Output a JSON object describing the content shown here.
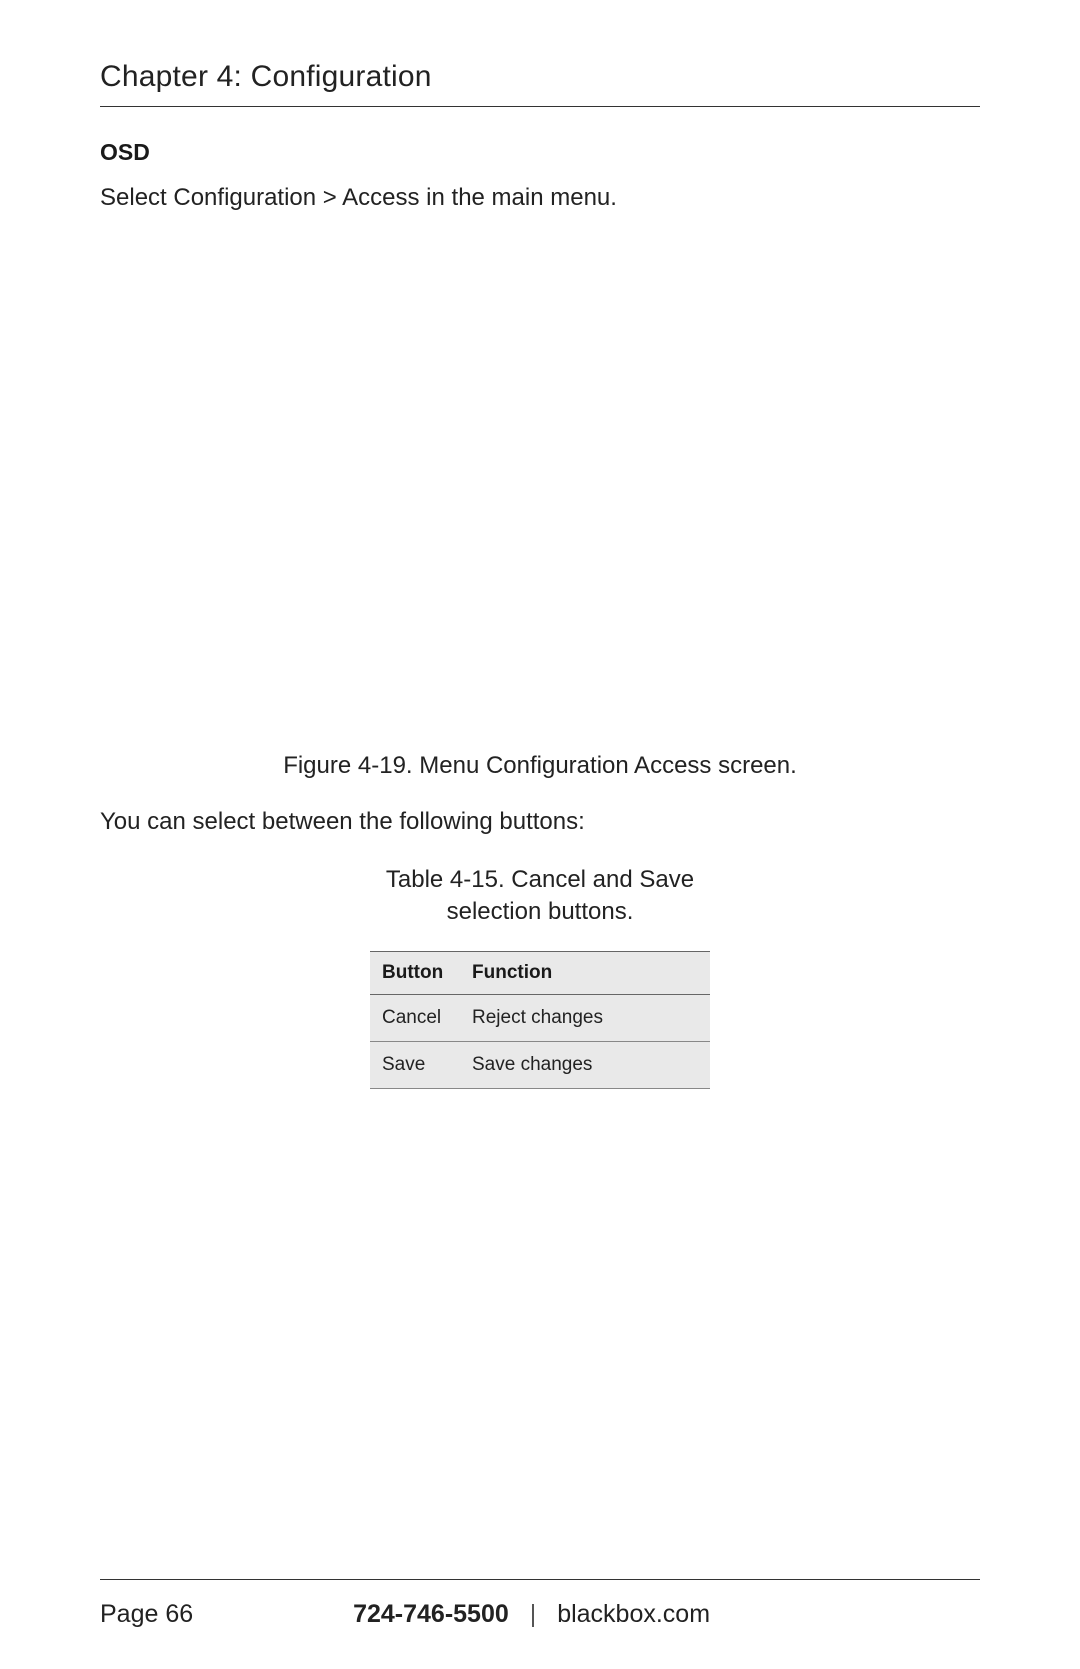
{
  "chapter_title": "Chapter 4: Configuration",
  "section_label": "OSD",
  "instruction": "Select Configuration > Access in the main menu.",
  "figure_caption": "Figure 4-19. Menu Configuration Access screen.",
  "body_text": "You can select between the following buttons:",
  "table_caption_line1": "Table 4-15. Cancel and Save",
  "table_caption_line2": "selection buttons.",
  "table": {
    "headers": {
      "col1": "Button",
      "col2": "Function"
    },
    "rows": [
      {
        "button": "Cancel",
        "function": "Reject changes"
      },
      {
        "button": "Save",
        "function": "Save changes"
      }
    ]
  },
  "footer": {
    "page": "Page 66",
    "phone": "724-746-5500",
    "divider": "|",
    "website": "blackbox.com"
  }
}
